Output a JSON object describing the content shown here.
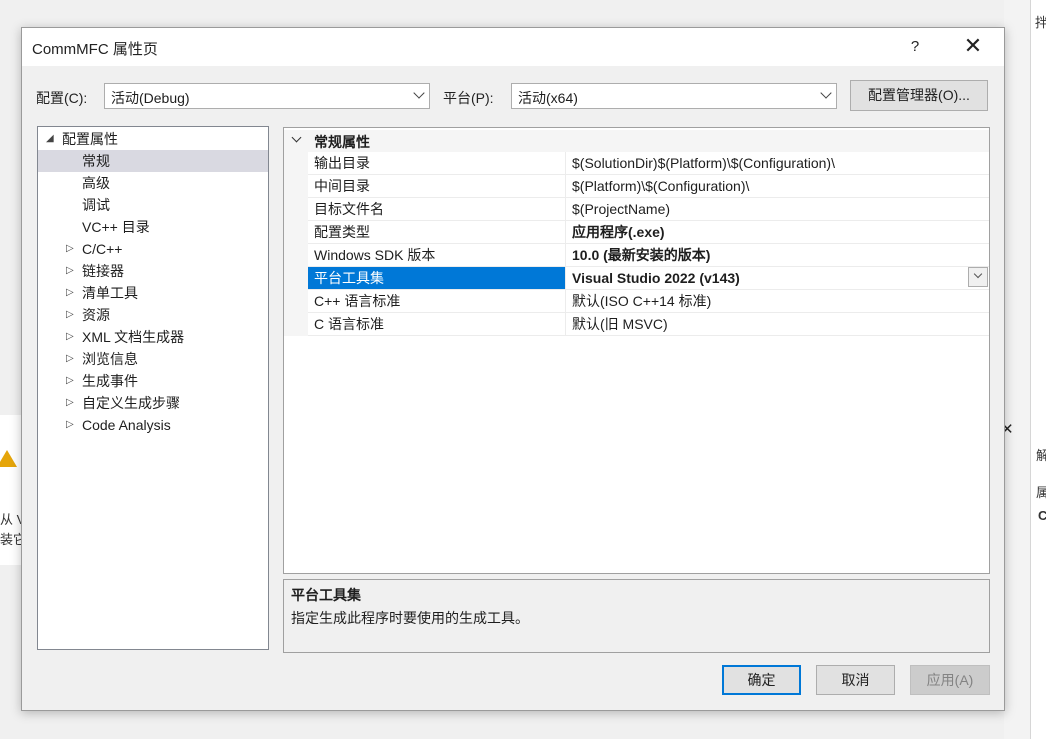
{
  "dialog": {
    "title": "CommMFC 属性页",
    "help": "?",
    "close": "✕"
  },
  "toolbar": {
    "config_label": "配置(C):",
    "config_value": "活动(Debug)",
    "platform_label": "平台(P):",
    "platform_value": "活动(x64)",
    "config_manager": "配置管理器(O)..."
  },
  "tree": {
    "root": {
      "label": "配置属性",
      "expanded": true
    },
    "items": [
      {
        "label": "常规",
        "selected": true,
        "has_children": false
      },
      {
        "label": "高级",
        "has_children": false
      },
      {
        "label": "调试",
        "has_children": false
      },
      {
        "label": "VC++ 目录",
        "has_children": false
      },
      {
        "label": "C/C++",
        "has_children": true
      },
      {
        "label": "链接器",
        "has_children": true
      },
      {
        "label": "清单工具",
        "has_children": true
      },
      {
        "label": "资源",
        "has_children": true
      },
      {
        "label": "XML 文档生成器",
        "has_children": true
      },
      {
        "label": "浏览信息",
        "has_children": true
      },
      {
        "label": "生成事件",
        "has_children": true
      },
      {
        "label": "自定义生成步骤",
        "has_children": true
      },
      {
        "label": "Code Analysis",
        "has_children": true
      }
    ]
  },
  "grid": {
    "category": "常规属性",
    "properties": [
      {
        "name": "输出目录",
        "value": "$(SolutionDir)$(Platform)\\$(Configuration)\\",
        "bold": false
      },
      {
        "name": "中间目录",
        "value": "$(Platform)\\$(Configuration)\\",
        "bold": false
      },
      {
        "name": "目标文件名",
        "value": "$(ProjectName)",
        "bold": false
      },
      {
        "name": "配置类型",
        "value": "应用程序(.exe)",
        "bold": true
      },
      {
        "name": "Windows SDK 版本",
        "value": "10.0 (最新安装的版本)",
        "bold": true
      },
      {
        "name": "平台工具集",
        "value": "Visual Studio 2022 (v143)",
        "bold": true,
        "selected": true
      },
      {
        "name": "C++ 语言标准",
        "value": "默认(ISO C++14 标准)",
        "bold": false
      },
      {
        "name": "C 语言标准",
        "value": "默认(旧 MSVC)",
        "bold": false
      }
    ]
  },
  "description": {
    "title": "平台工具集",
    "text": "指定生成此程序时要使用的生成工具。"
  },
  "buttons": {
    "ok": "确定",
    "cancel": "取消",
    "apply": "应用(A)"
  },
  "background": {
    "frag_search": "拌",
    "frag_solve": "解",
    "frag_prop": "属",
    "frag_c": "C",
    "left_line1": "从 V",
    "left_line2": "装它"
  },
  "colors": {
    "selection": "#0078d7",
    "tree_selection": "#d9d9e1",
    "dialog_bg": "#f0f0f0"
  }
}
